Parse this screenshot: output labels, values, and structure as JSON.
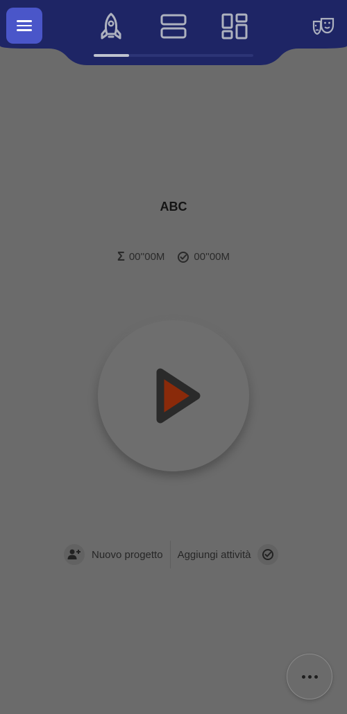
{
  "header": {
    "tabs": [
      {
        "icon": "rocket-icon",
        "active": true
      },
      {
        "icon": "list-view-icon",
        "active": false
      },
      {
        "icon": "dashboard-icon",
        "active": false
      }
    ],
    "indicator_progress": 0.22,
    "right_icon": "theater-masks-icon",
    "menu_icon": "hamburger-menu-icon",
    "colors": {
      "bar": "#1e2565",
      "menu_button": "#4a56c9",
      "icons": "#aeb2bf"
    }
  },
  "project": {
    "title": "ABC"
  },
  "stats": {
    "total_icon": "sigma-icon",
    "total_value": "00''00M",
    "target_icon": "target-icon",
    "target_value": "00''00M"
  },
  "player": {
    "icon": "play-icon",
    "colors": {
      "outline": "#2a2a2a",
      "fill": "#8a2a0a"
    }
  },
  "actions": {
    "new_project_label": "Nuovo progetto",
    "add_activity_label": "Aggiungi attività"
  },
  "fab": {
    "icon": "more-options-icon"
  }
}
